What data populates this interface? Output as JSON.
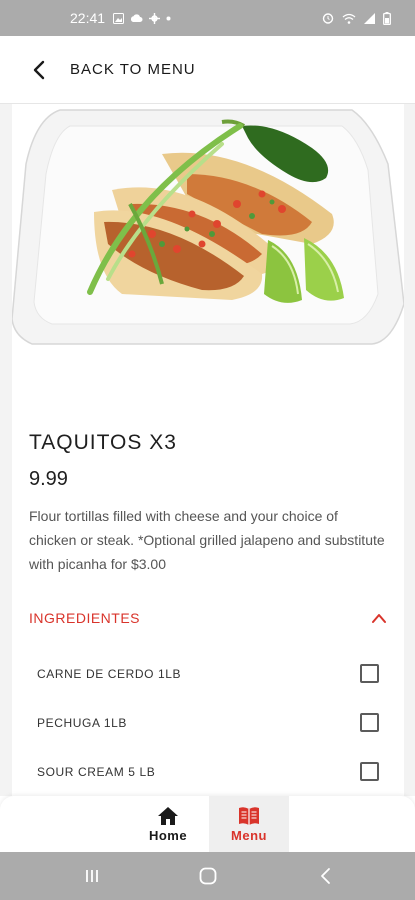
{
  "status_bar": {
    "time": "22:41",
    "left_icons": [
      "image-icon",
      "cloud-icon",
      "gear-icon",
      "dot-icon"
    ],
    "right_icons": [
      "alarm-icon",
      "wifi-icon",
      "signal-icon",
      "battery-icon"
    ]
  },
  "header": {
    "back_label": "BACK TO MENU"
  },
  "product": {
    "title": "TAQUITOS X3",
    "price": "9.99",
    "description": "Flour tortillas filled with cheese and your choice of chicken or steak. *Optional grilled jalapeno and substitute with picanha for $3.00",
    "image_icon": "tacos-plate-image"
  },
  "ingredients": {
    "title": "INGREDIENTES",
    "expanded": true,
    "items": [
      {
        "name": "CARNE DE CERDO 1LB",
        "checked": false
      },
      {
        "name": "PECHUGA 1LB",
        "checked": false
      },
      {
        "name": "SOUR CREAM 5 LB",
        "checked": false
      }
    ]
  },
  "bottom_nav": {
    "items": [
      {
        "label": "Home",
        "icon": "home-icon",
        "active": false
      },
      {
        "label": "Menu",
        "icon": "menu-book-icon",
        "active": true
      }
    ]
  },
  "colors": {
    "accent": "#d9342b",
    "system_bar": "#ababab"
  }
}
